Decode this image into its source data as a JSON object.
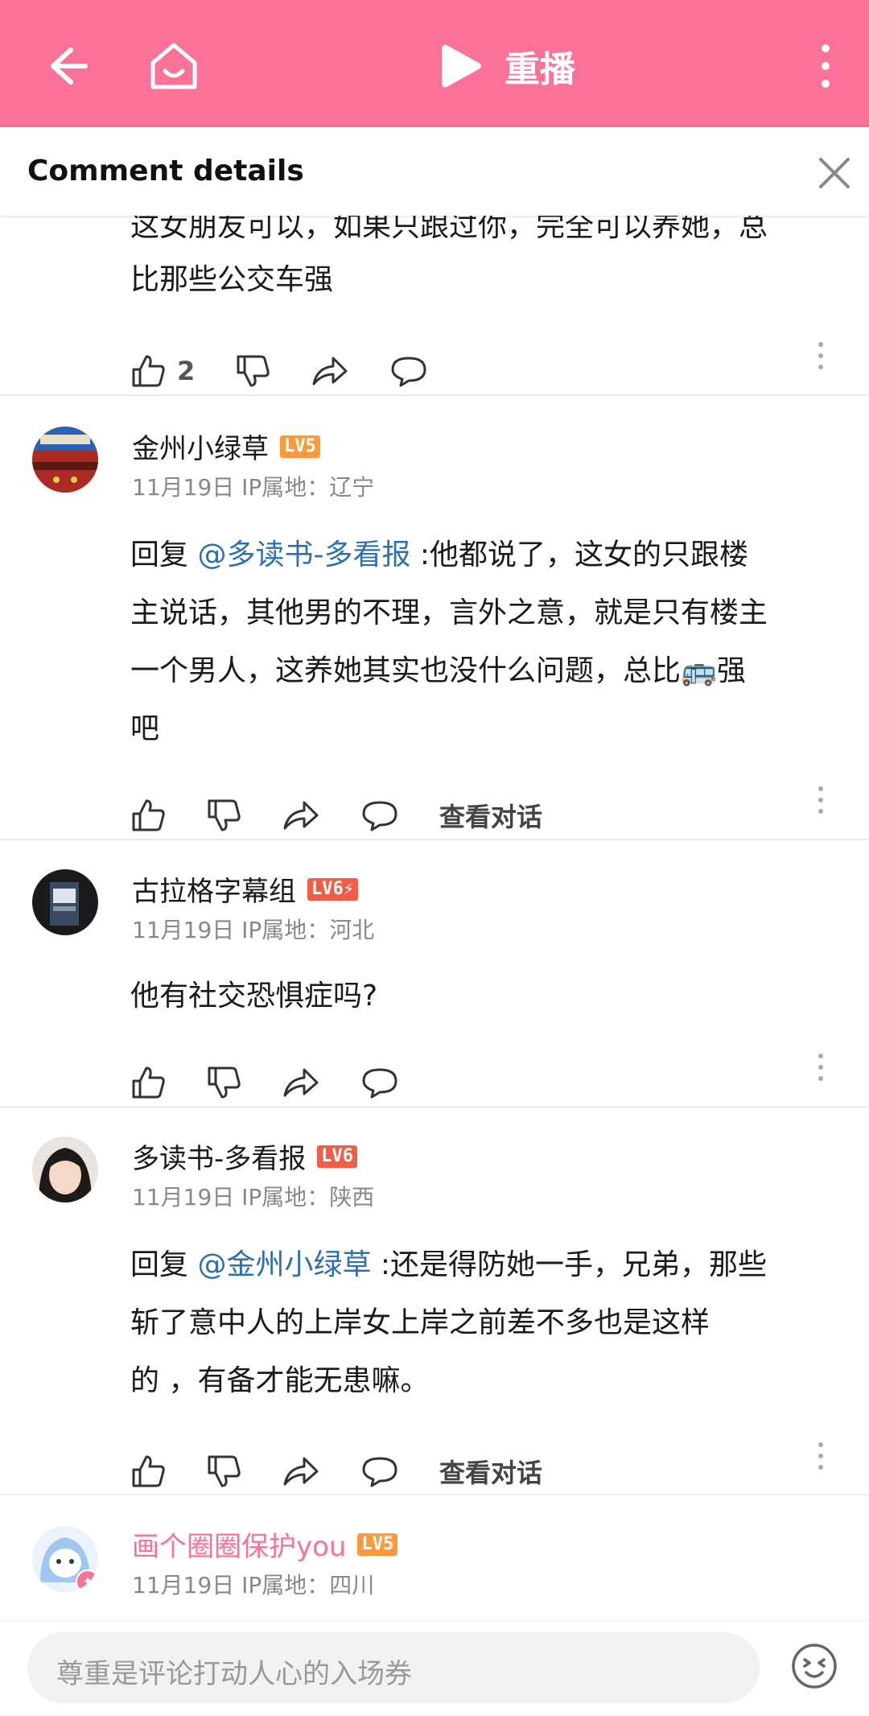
{
  "topbar": {
    "replay_label": "重播"
  },
  "header": {
    "title": "Comment details"
  },
  "comments": [
    {
      "text_lines": [
        "这女朋友可以，如果只跟过你，完全可以养她，总",
        "比那些公交车强"
      ],
      "likes": "2"
    },
    {
      "username": "金州小绿草",
      "level": "LV5",
      "meta": "11月19日 IP属地：辽宁",
      "reply_prefix": "回复 ",
      "mention": "@多读书-多看报",
      "text_first": " :他都说了，这女的只跟楼",
      "text_lines": [
        "主说话，其他男的不理，言外之意，就是只有楼主",
        "一个男人，这养她其实也没什么问题，总比🚌强",
        "吧"
      ],
      "view_conversation": "查看对话"
    },
    {
      "username": "古拉格字幕组",
      "level": "LV6⚡",
      "meta": "11月19日 IP属地：河北",
      "text": "他有社交恐惧症吗?"
    },
    {
      "username": "多读书-多看报",
      "level": "LV6",
      "meta": "11月19日 IP属地：陕西",
      "reply_prefix": "回复 ",
      "mention": "@金州小绿草",
      "text_first": " :还是得防她一手，兄弟，那些",
      "text_lines": [
        "斩了意中人的上岸女上岸之前差不多也是这样",
        "的 ，有备才能无患嘛。"
      ],
      "view_conversation": "查看对话"
    },
    {
      "username": "画个圈圈保护you",
      "level": "LV5",
      "meta": "11月19日 IP属地：四川"
    }
  ],
  "bottom": {
    "placeholder": "尊重是评论打动人心的入场券"
  },
  "colors": {
    "brand_pink": "#fb7299",
    "mention_blue": "#2e6fae"
  }
}
